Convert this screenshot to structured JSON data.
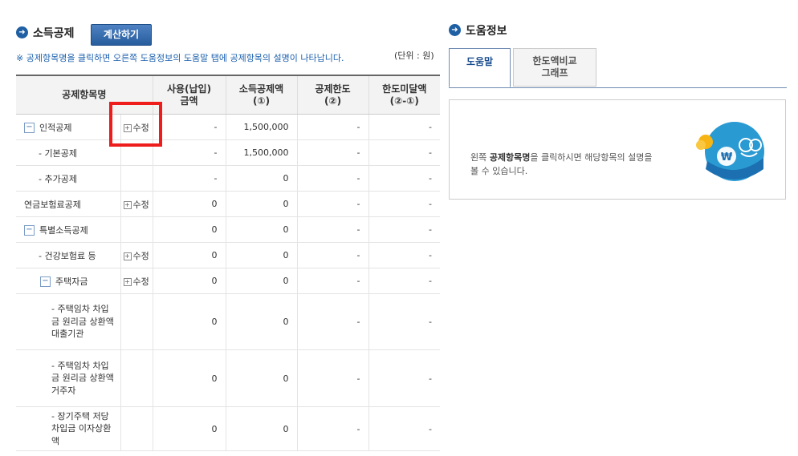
{
  "left": {
    "title": "소득공제",
    "calc_button": "계산하기",
    "notice": "※ 공제항목명을 클릭하면 오른쪽 도움정보의 도움말 탭에 공제항목의 설명이 나타납니다.",
    "unit": "(단위 : 원)"
  },
  "table": {
    "headers": [
      "공제항목명",
      "사용(납입)\n금액",
      "소득공제액\n(①)",
      "공제한도\n(②)",
      "한도미달액\n(②-①)"
    ],
    "edit_label": "수정",
    "rows": [
      {
        "name": "인적공제",
        "amount": "-",
        "deduction": "1,500,000",
        "limit": "-",
        "shortfall": "-"
      },
      {
        "name": "- 기본공제",
        "amount": "-",
        "deduction": "1,500,000",
        "limit": "-",
        "shortfall": "-"
      },
      {
        "name": "- 추가공제",
        "amount": "-",
        "deduction": "0",
        "limit": "-",
        "shortfall": "-"
      },
      {
        "name": "연금보험료공제",
        "amount": "0",
        "deduction": "0",
        "limit": "-",
        "shortfall": "-"
      },
      {
        "name": "특별소득공제",
        "amount": "0",
        "deduction": "0",
        "limit": "-",
        "shortfall": "-"
      },
      {
        "name": "- 건강보험료 등",
        "amount": "0",
        "deduction": "0",
        "limit": "-",
        "shortfall": "-"
      },
      {
        "name": "주택자금",
        "amount": "0",
        "deduction": "0",
        "limit": "-",
        "shortfall": "-"
      },
      {
        "name": "- 주택임차 차입금 원리금 상환액 대출기관",
        "amount": "0",
        "deduction": "0",
        "limit": "-",
        "shortfall": "-"
      },
      {
        "name": "- 주택임차 차입금 원리금 상환액 거주자",
        "amount": "0",
        "deduction": "0",
        "limit": "-",
        "shortfall": "-"
      },
      {
        "name": "- 장기주택 저당차입금 이자상환액",
        "amount": "0",
        "deduction": "0",
        "limit": "-",
        "shortfall": "-"
      }
    ]
  },
  "right": {
    "title": "도움정보",
    "tabs": [
      {
        "label": "도움말"
      },
      {
        "label": "한도액비교\n그래프"
      }
    ],
    "help_prefix": "왼쪽 ",
    "help_bold": "공제항목명",
    "help_suffix": "을 클릭하시면 해당항목의 설명을 볼 수 있습니다.",
    "won_symbol": "₩"
  },
  "colors": {
    "accent": "#1f5fa3",
    "highlight": "#ee1c1c",
    "notice": "#1a5fae"
  }
}
